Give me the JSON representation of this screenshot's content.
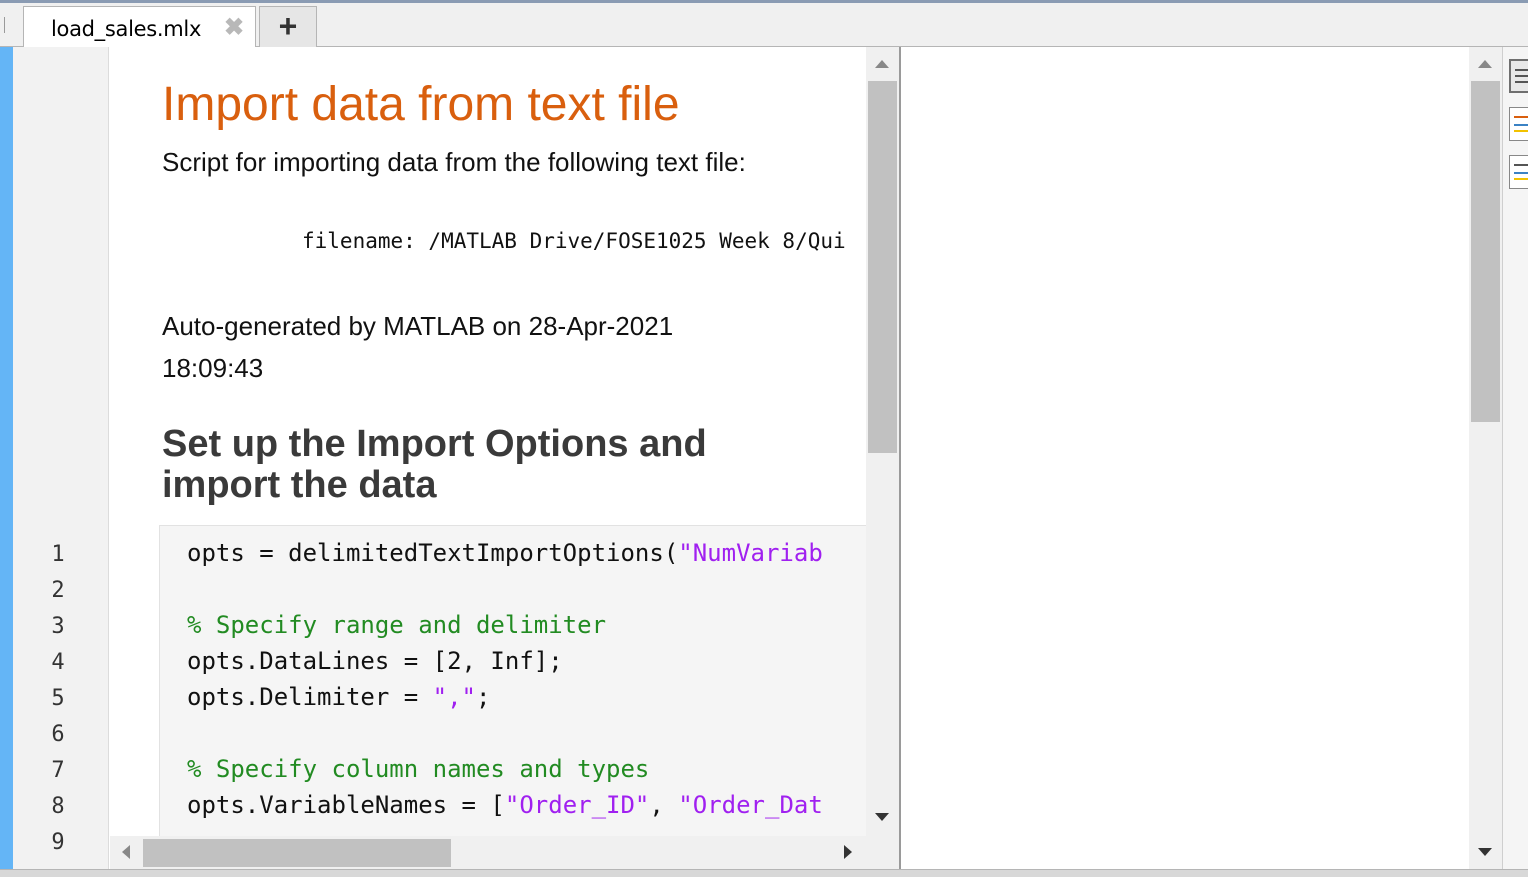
{
  "tab": {
    "label": "load_sales.mlx",
    "close_glyph": "✖",
    "add_glyph": "+"
  },
  "gutter": {
    "line_numbers": [
      "1",
      "2",
      "3",
      "4",
      "5",
      "6",
      "7",
      "8",
      "9"
    ]
  },
  "doc": {
    "title": "Import data from text file",
    "intro": "Script for importing data from the following text file:",
    "filename_line": "filename: /MATLAB Drive/FOSE1025 Week 8/Qui",
    "autogen_line1": "Auto-generated by MATLAB on 28-Apr-2021",
    "autogen_line2": "18:09:43",
    "section_heading_line1": "Set up the Import Options and",
    "section_heading_line2": "import the data"
  },
  "code": {
    "l1_a": "opts = delimitedTextImportOptions(",
    "l1_b": "\"NumVariab",
    "l3": "% Specify range and delimiter",
    "l4": "opts.DataLines = [2, Inf];",
    "l5_a": "opts.Delimiter = ",
    "l5_b": "\",\"",
    "l5_c": ";",
    "l7": "% Specify column names and types",
    "l8_a": "opts.VariableNames = [",
    "l8_b": "\"Order_ID\"",
    "l8_c": ", ",
    "l8_d": "\"Order_Dat"
  },
  "colors": {
    "title": "#d95f0e",
    "string": "#a020f0",
    "comment": "#228b22",
    "left_strip": "#64b5f6"
  },
  "icons": [
    "close-icon",
    "add-tab-icon",
    "scroll-up-icon",
    "scroll-down-icon",
    "scroll-left-icon",
    "scroll-right-icon",
    "output-inline-icon",
    "output-right-icon",
    "hide-code-icon"
  ]
}
